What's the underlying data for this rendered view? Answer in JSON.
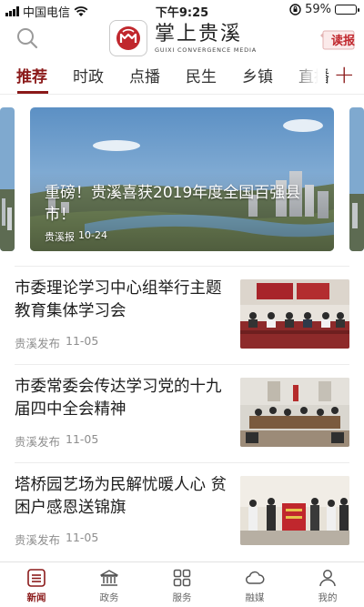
{
  "status_bar": {
    "carrier": "中国电信",
    "time": "下午9:25",
    "battery": "59%",
    "battery_level": 0.59
  },
  "header": {
    "logo_cn": "掌上贵溪",
    "logo_en": "GUIXI CONVERGENCE MEDIA",
    "read_paper_label": "读报"
  },
  "tabs": [
    {
      "label": "推荐",
      "active": true
    },
    {
      "label": "时政",
      "active": false
    },
    {
      "label": "点播",
      "active": false
    },
    {
      "label": "民生",
      "active": false
    },
    {
      "label": "乡镇",
      "active": false
    },
    {
      "label": "直播",
      "active": false
    }
  ],
  "banner": {
    "title": "重磅！贵溪喜获2019年度全国百强县市！",
    "source": "贵溪报",
    "date": "10-24"
  },
  "news": [
    {
      "title": "市委理论学习中心组举行主题教育集体学习会",
      "source": "贵溪发布",
      "date": "11-05"
    },
    {
      "title": "市委常委会传达学习党的十九届四中全会精神",
      "source": "贵溪发布",
      "date": "11-05"
    },
    {
      "title": "塔桥园艺场为民解忧暖人心 贫困户感恩送锦旗",
      "source": "贵溪发布",
      "date": "11-05"
    }
  ],
  "bottom_nav": [
    {
      "label": "新闻",
      "icon": "list-icon",
      "active": true
    },
    {
      "label": "政务",
      "icon": "government-building-icon",
      "active": false
    },
    {
      "label": "服务",
      "icon": "grid-icon",
      "active": false
    },
    {
      "label": "融媒",
      "icon": "cloud-icon",
      "active": false
    },
    {
      "label": "我的",
      "icon": "person-icon",
      "active": false
    }
  ],
  "colors": {
    "accent": "#8b1a1a",
    "read_paper": "#c0272d",
    "meta_text": "#8e8e8e"
  }
}
